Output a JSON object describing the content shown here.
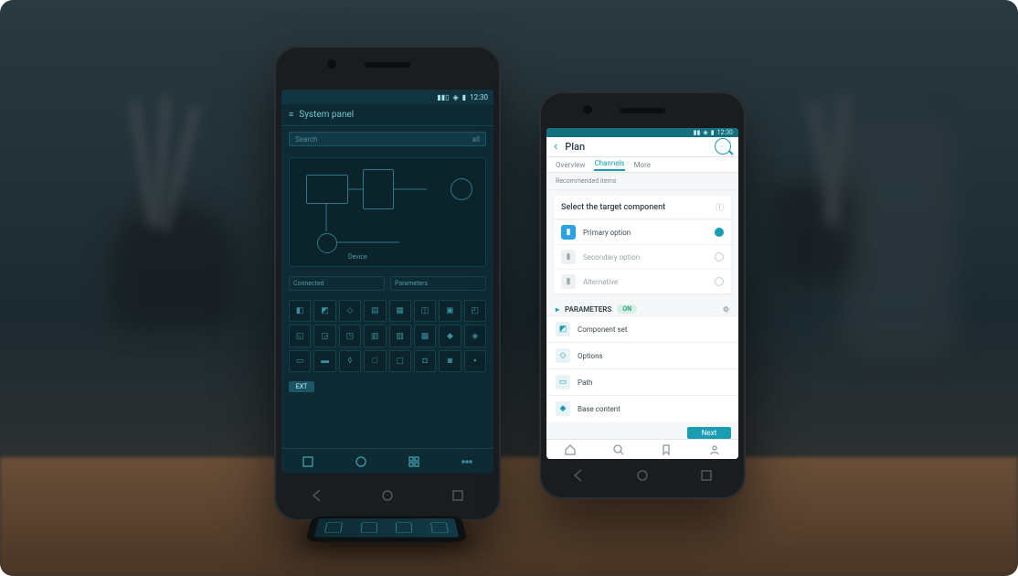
{
  "phoneA": {
    "statusbar_time": "12:30",
    "header_title": "System panel",
    "search_placeholder": "Search",
    "search_suffix": "all",
    "diagram_label": "Device",
    "info_left": "Connected",
    "info_right": "Parameters",
    "grid_tag": "EXT",
    "nav_items": [
      "home",
      "apps",
      "grid",
      "more"
    ]
  },
  "phoneB": {
    "statusbar_time": "12:30",
    "header_title": "Plan",
    "tabs": [
      "Overview",
      "Channels",
      "More"
    ],
    "remark_text": "Recommended items",
    "card_title": "Select the target component",
    "card_rows": [
      {
        "color": "#2aa3e0",
        "label": "Primary option"
      },
      {
        "color": "#f2f4f5",
        "label": "Secondary option",
        "muted": true
      },
      {
        "color": "#f2f4f5",
        "label": "Alternative",
        "muted": true
      }
    ],
    "section_title": "PARAMETERS",
    "section_pill": "ON",
    "list": [
      {
        "icon": "◩",
        "label": "Component set"
      },
      {
        "icon": "◇",
        "label": "Options"
      },
      {
        "icon": "▭",
        "label": "Path"
      },
      {
        "icon": "◆",
        "label": "Base content"
      }
    ],
    "cta_label": "Next"
  }
}
